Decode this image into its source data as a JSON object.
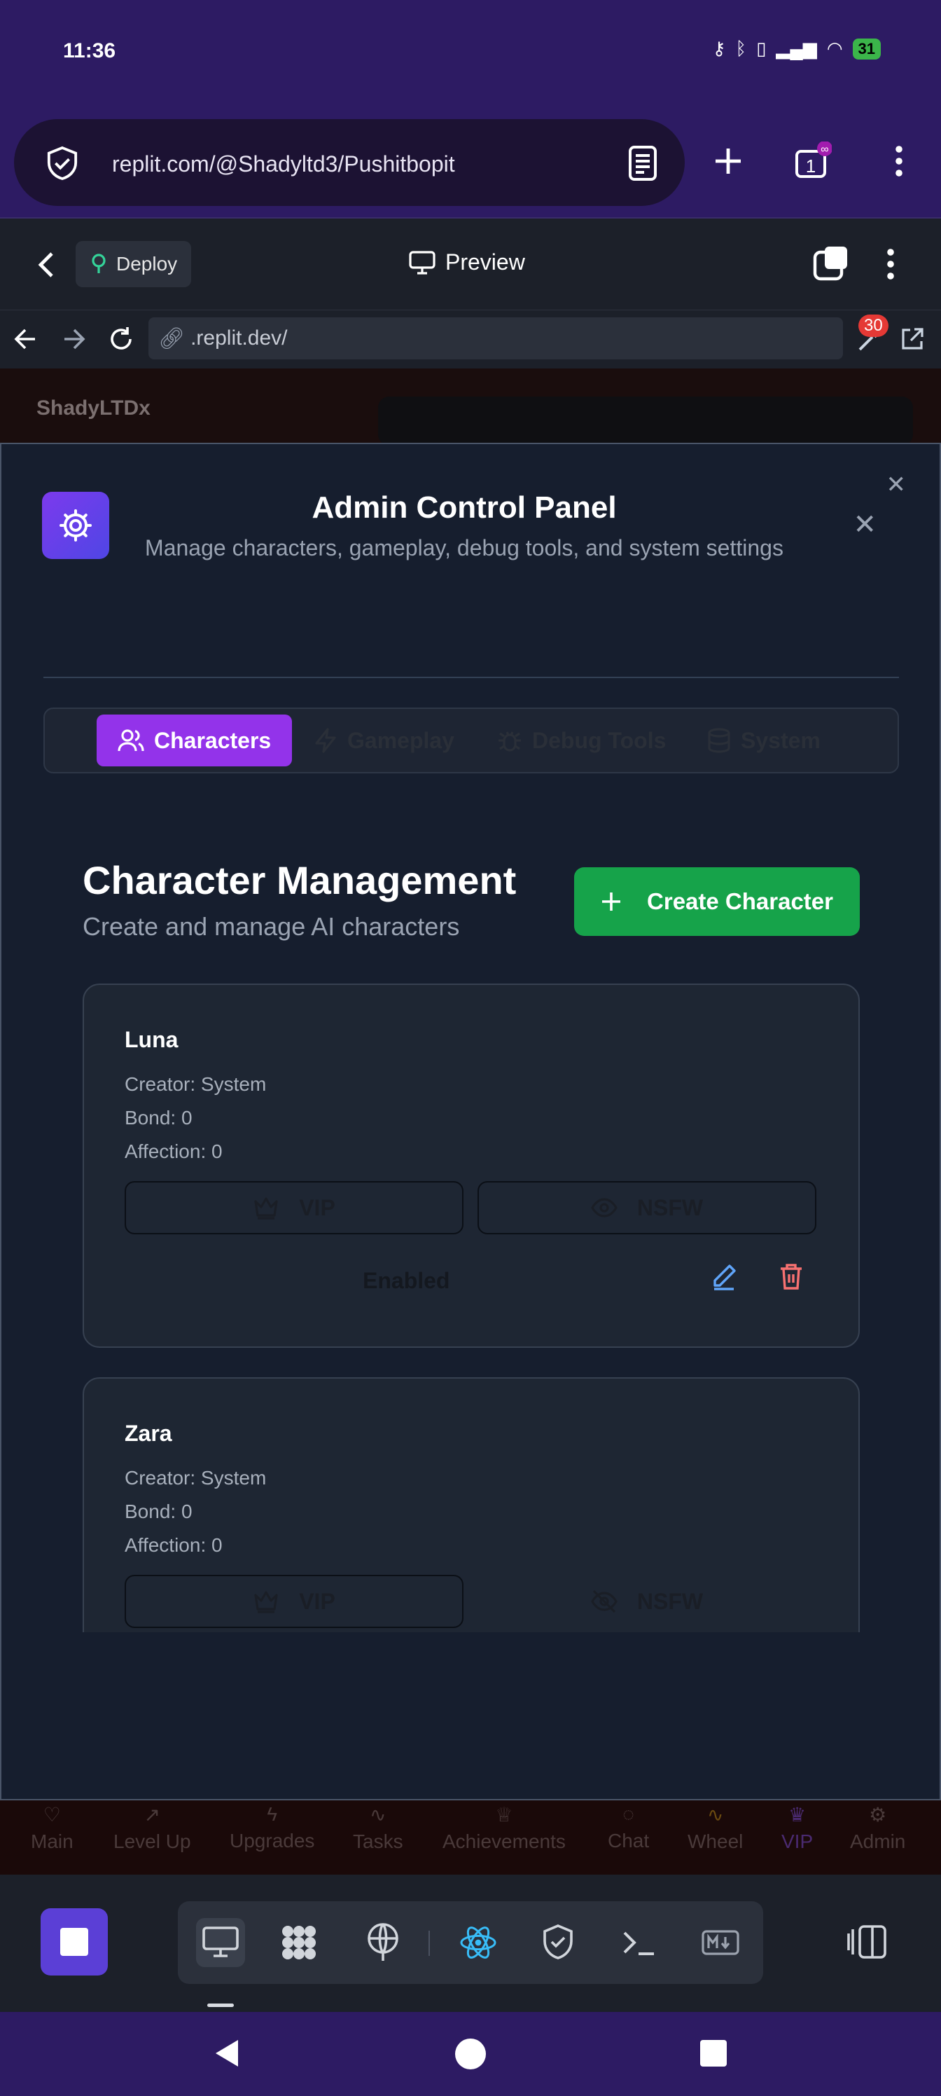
{
  "status_bar": {
    "time": "11:36",
    "battery": "31"
  },
  "browser": {
    "url": "replit.com/@Shadyltd3/Pushitbopit",
    "tabs_count": "1"
  },
  "replit_header": {
    "deploy_label": "Deploy",
    "preview_label": "Preview"
  },
  "webview": {
    "url": ".replit.dev/",
    "badge_count": "30"
  },
  "background_page": {
    "brand": "ShadyLTDx"
  },
  "modal": {
    "title": "Admin Control Panel",
    "subtitle": "Manage characters, gameplay, debug tools, and system settings",
    "tabs": [
      {
        "label": "Characters",
        "icon": "users-icon",
        "active": true
      },
      {
        "label": "Gameplay",
        "icon": "lightning-icon",
        "active": false
      },
      {
        "label": "Debug Tools",
        "icon": "bug-icon",
        "active": false
      },
      {
        "label": "System",
        "icon": "database-icon",
        "active": false
      }
    ],
    "section_title": "Character Management",
    "section_subtitle": "Create and manage AI characters",
    "create_button": "Create Character",
    "characters": [
      {
        "name": "Luna",
        "creator": "Creator: System",
        "bond": "Bond: 0",
        "affection": "Affection: 0",
        "vip_label": "VIP",
        "nsfw_label": "NSFW",
        "status": "Enabled"
      },
      {
        "name": "Zara",
        "creator": "Creator: System",
        "bond": "Bond: 0",
        "affection": "Affection: 0",
        "vip_label": "VIP",
        "nsfw_label": "NSFW"
      }
    ]
  },
  "app_nav": [
    {
      "label": "Main",
      "icon": "heart-icon"
    },
    {
      "label": "Level Up",
      "icon": "trending-up-icon"
    },
    {
      "label": "Upgrades",
      "icon": "lightning-icon"
    },
    {
      "label": "Tasks",
      "icon": "activity-icon"
    },
    {
      "label": "Achievements",
      "icon": "trophy-icon"
    },
    {
      "label": "Chat",
      "icon": "chat-icon"
    },
    {
      "label": "Wheel",
      "icon": "activity-icon"
    },
    {
      "label": "VIP",
      "icon": "crown-icon"
    },
    {
      "label": "Admin",
      "icon": "gear-icon"
    }
  ],
  "colors": {
    "accent_purple": "#9333ea",
    "create_green": "#16a34a",
    "modal_bg": "#161e2e"
  }
}
